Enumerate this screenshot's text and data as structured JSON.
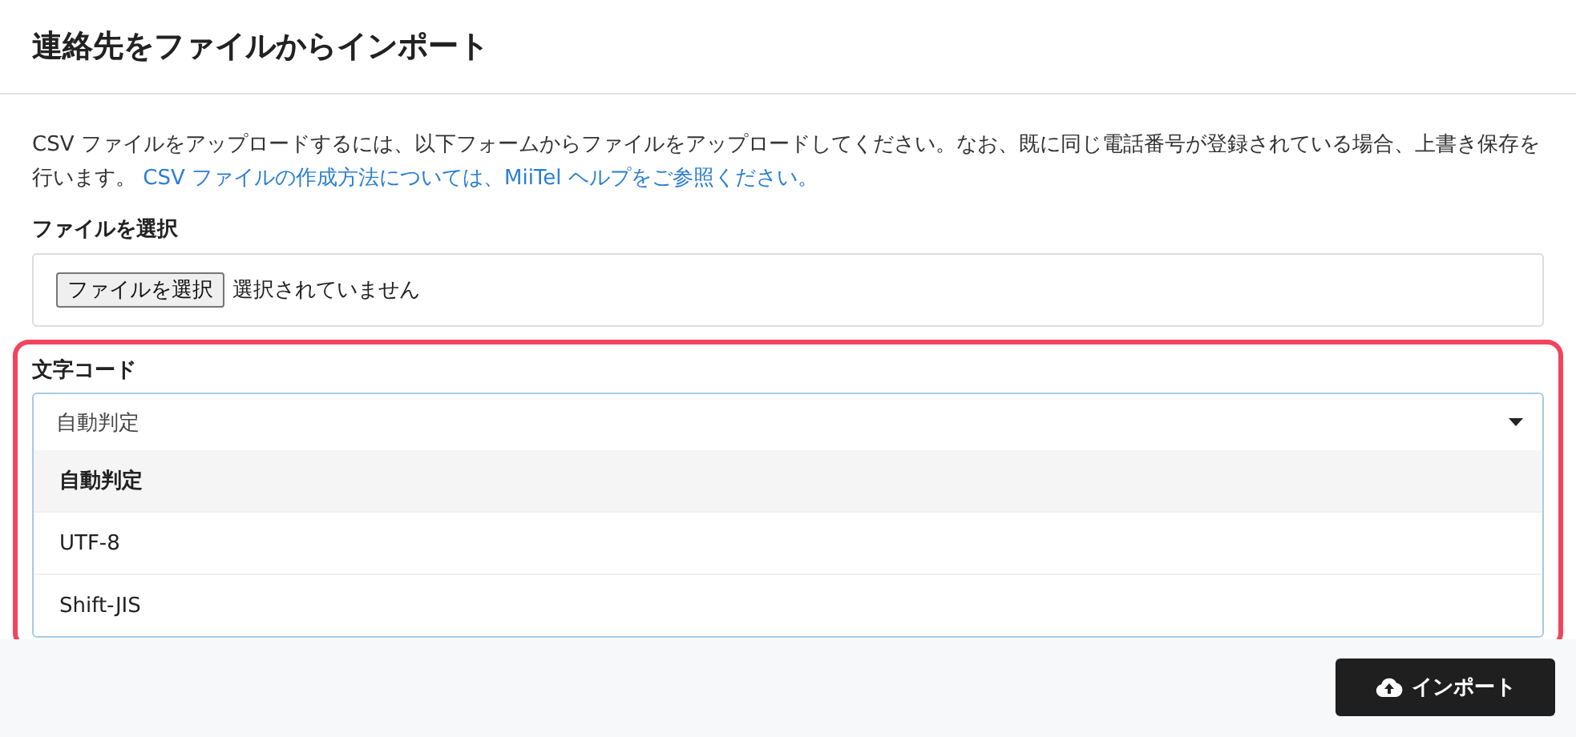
{
  "dialog": {
    "title": "連絡先をファイルからインポート"
  },
  "intro": {
    "text": "CSV ファイルをアップロードするには、以下フォームからファイルをアップロードしてください。なお、既に同じ電話番号が登録されている場合、上書き保存を行います。",
    "link": "CSV ファイルの作成方法については、MiiTel ヘルプをご参照ください。"
  },
  "file_field": {
    "label": "ファイルを選択",
    "button": "ファイルを選択",
    "status": "選択されていません"
  },
  "encoding": {
    "label": "文字コード",
    "value": "自動判定",
    "expanded": true,
    "options": [
      {
        "label": "自動判定",
        "selected": true
      },
      {
        "label": "UTF-8",
        "selected": false
      },
      {
        "label": "Shift-JIS",
        "selected": false
      }
    ]
  },
  "import_button": {
    "label": "インポート"
  }
}
